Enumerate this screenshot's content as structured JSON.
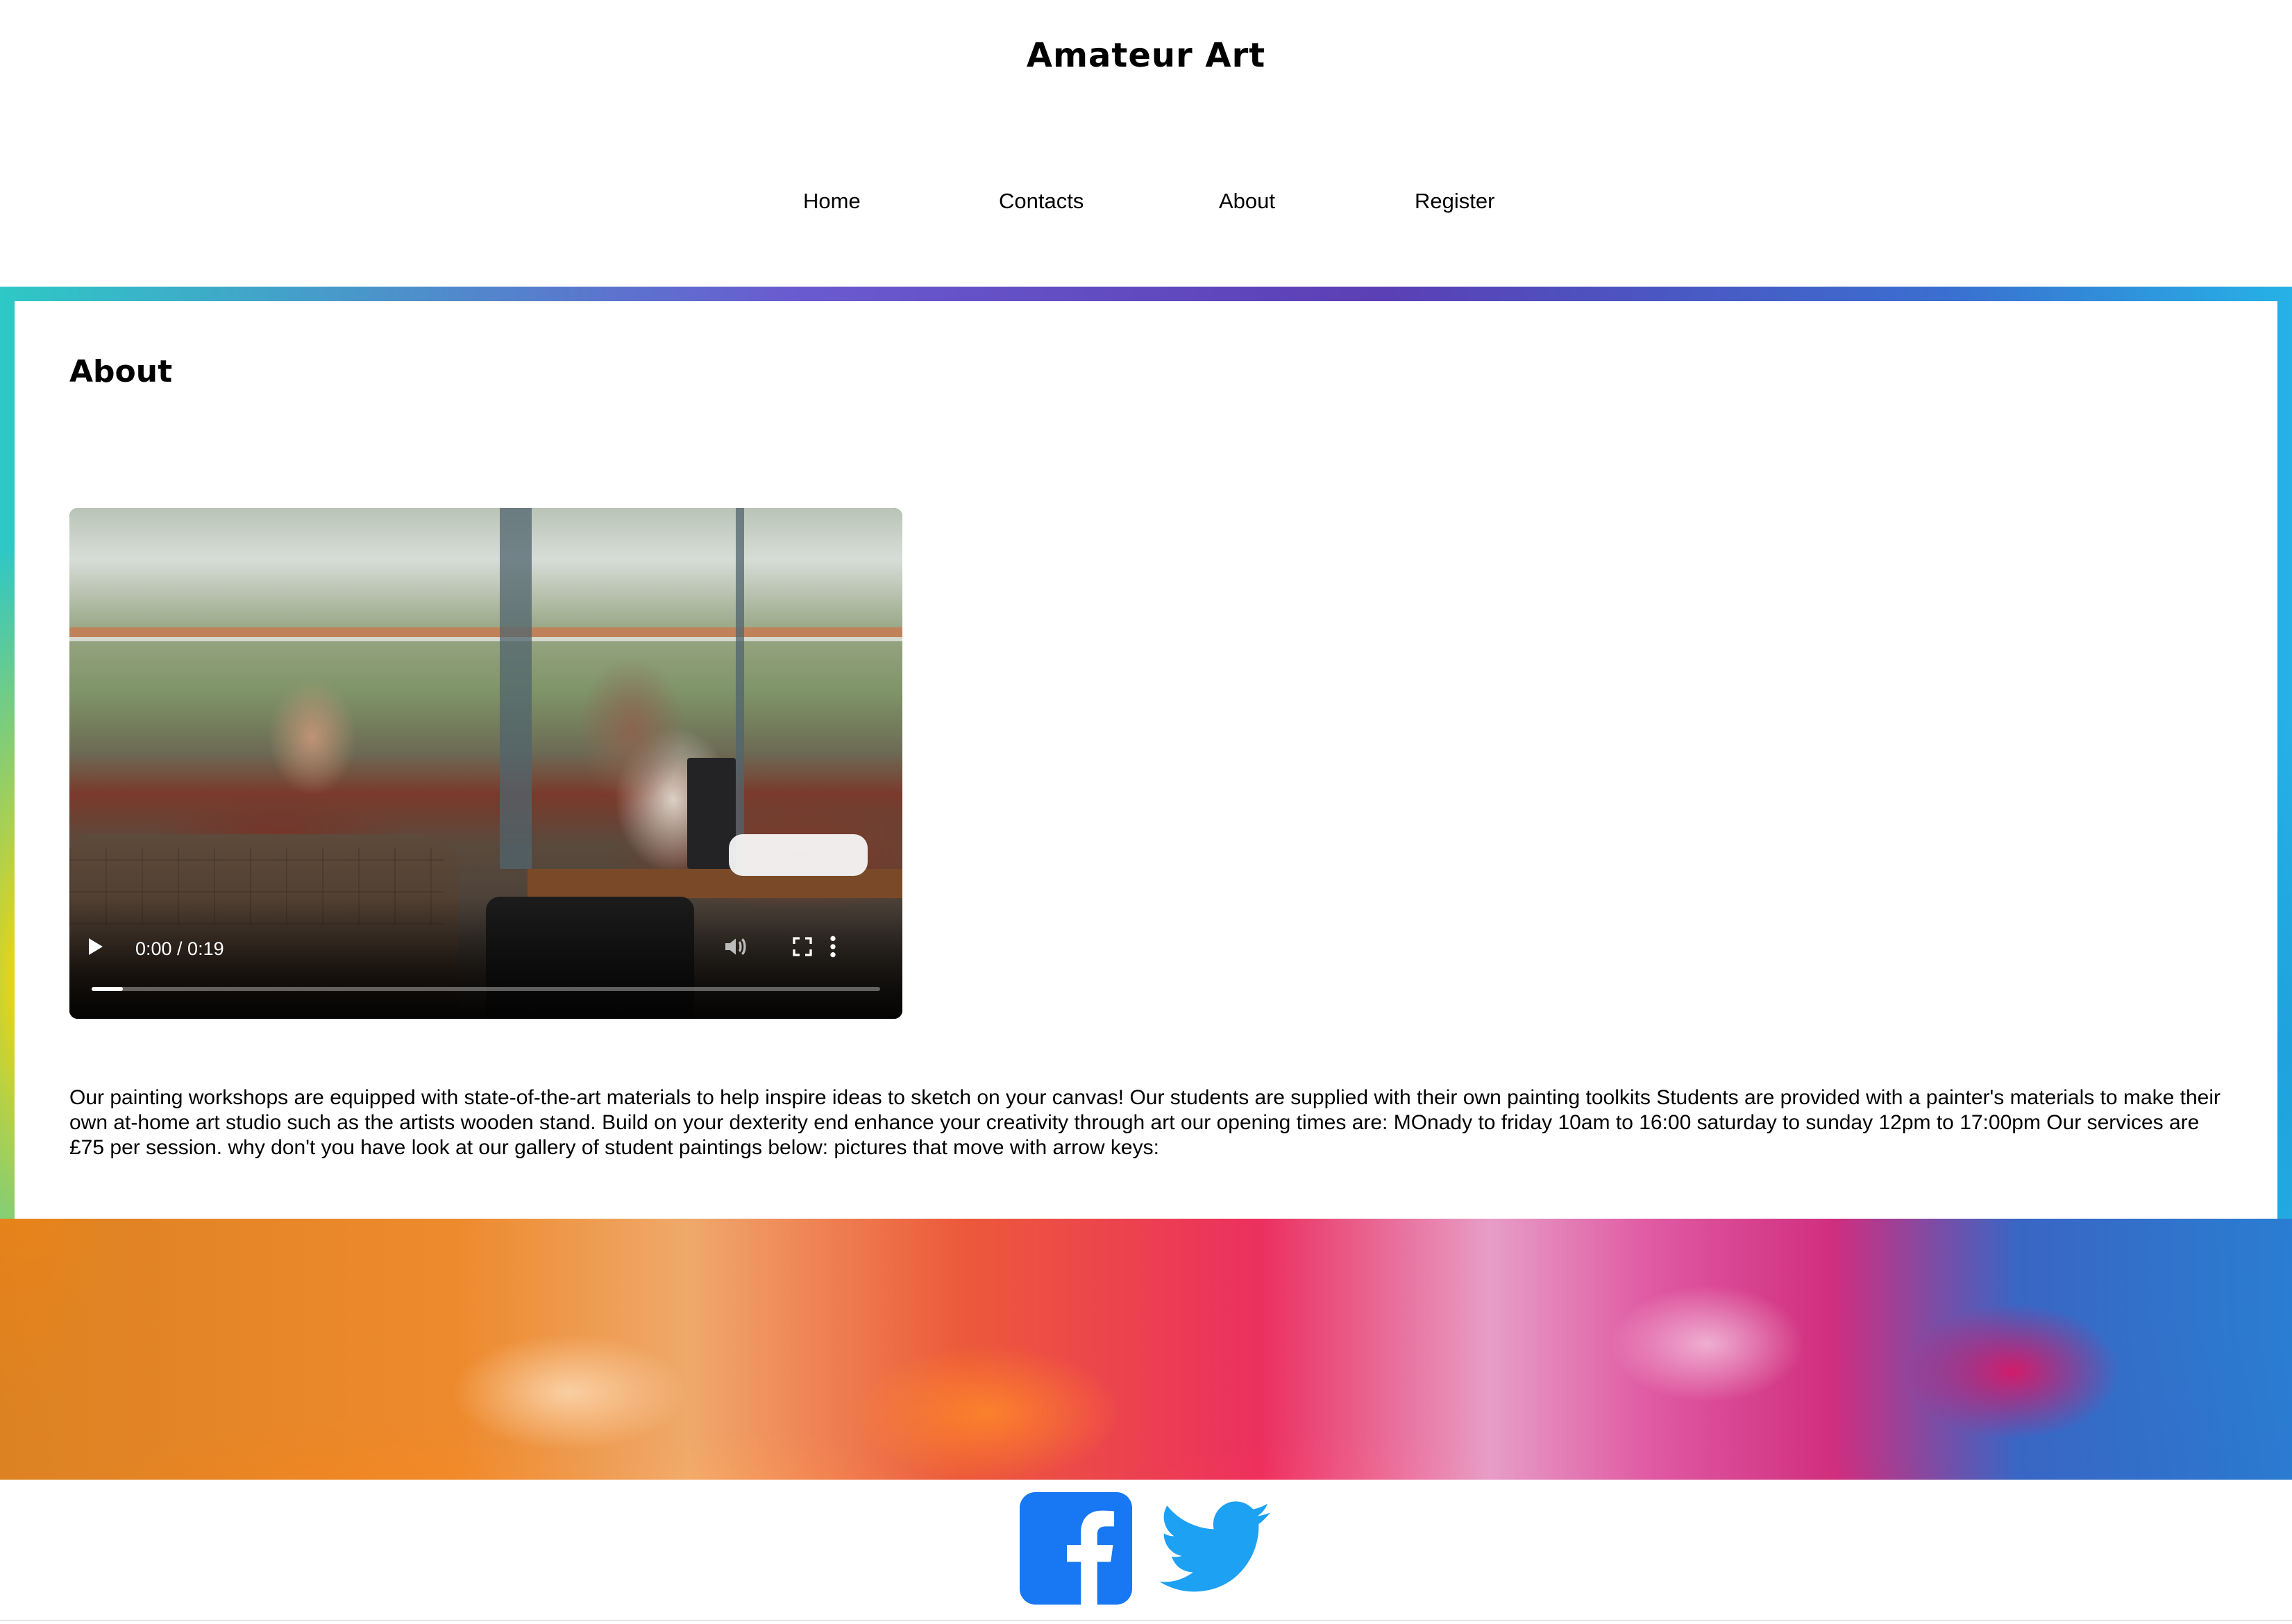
{
  "site": {
    "title": "Amateur Art"
  },
  "nav": {
    "items": [
      "Home",
      "Contacts",
      "About",
      "Register"
    ]
  },
  "main": {
    "heading": "About",
    "video": {
      "time_display": "0:00 / 0:19",
      "progress": 0.04
    },
    "paragraph": "Our painting workshops are equipped with state-of-the-art materials to help inspire ideas to sketch on your canvas! Our students are supplied with their own painting toolkits Students are provided with a painter's materials to make their own at-home art studio such as the artists wooden stand. Build on your dexterity end enhance your creativity through art our opening times are: MOnady to friday 10am to 16:00 saturday to sunday 12pm to 17:00pm Our services are £75 per session. why don't you have look at our gallery of student paintings below: pictures that move with arrow keys:"
  },
  "footer": {
    "icons": [
      "facebook-icon",
      "twitter-icon"
    ]
  },
  "colors": {
    "facebook_blue": "#1877F2",
    "twitter_blue": "#1DA1F2"
  }
}
